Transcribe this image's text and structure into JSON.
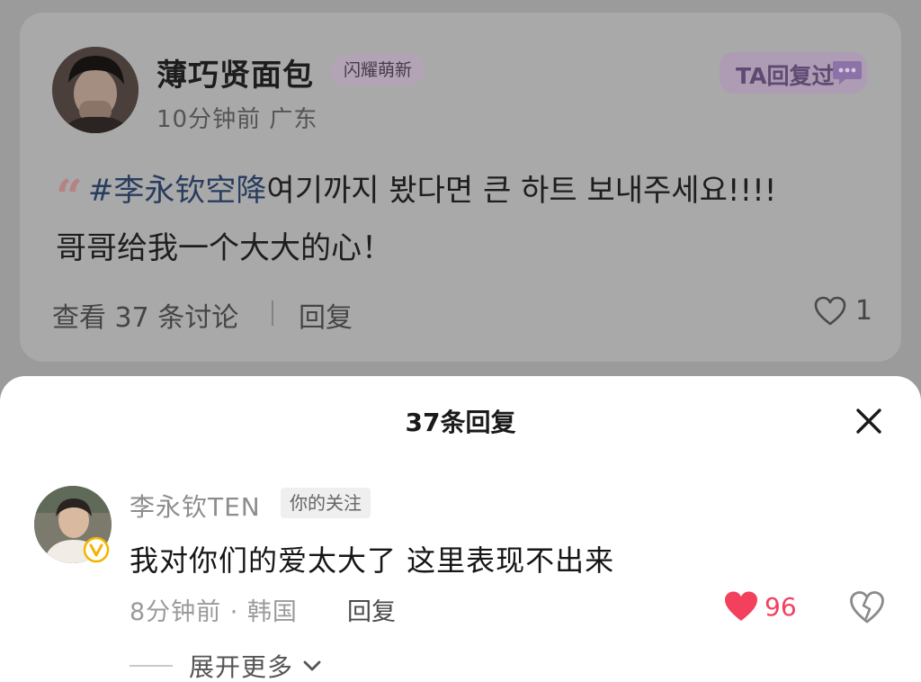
{
  "post": {
    "author": "薄巧贤面包",
    "badge": "闪耀萌新",
    "meta": "10分钟前 广东",
    "ta_replied_label": "TA回复过",
    "quote_mark": "“",
    "hashtag": "#李永钦空降",
    "text_line1": "여기까지 봤다면 큰 하트 보내주세요!!!!",
    "text_line2": "哥哥给我一个大大的心！",
    "view_discussion": "查看 37 条讨论",
    "reply_label": "回复",
    "like_count": "1"
  },
  "sheet": {
    "title": "37条回复",
    "comment": {
      "author": "李永钦TEN",
      "follow_badge": "你的关注",
      "text": "我对你们的爱太大了 这里表现不出来",
      "meta": "8分钟前 · 韩国",
      "reply_label": "回复",
      "like_count": "96",
      "liked": true
    },
    "expand_label": "展开更多"
  },
  "colors": {
    "overlay_bg": "#9b9b9b",
    "card_bg": "#a9a9a9",
    "hashtag": "#283d5e",
    "like_red": "#f2405d",
    "verified_gold": "#f4b400"
  }
}
